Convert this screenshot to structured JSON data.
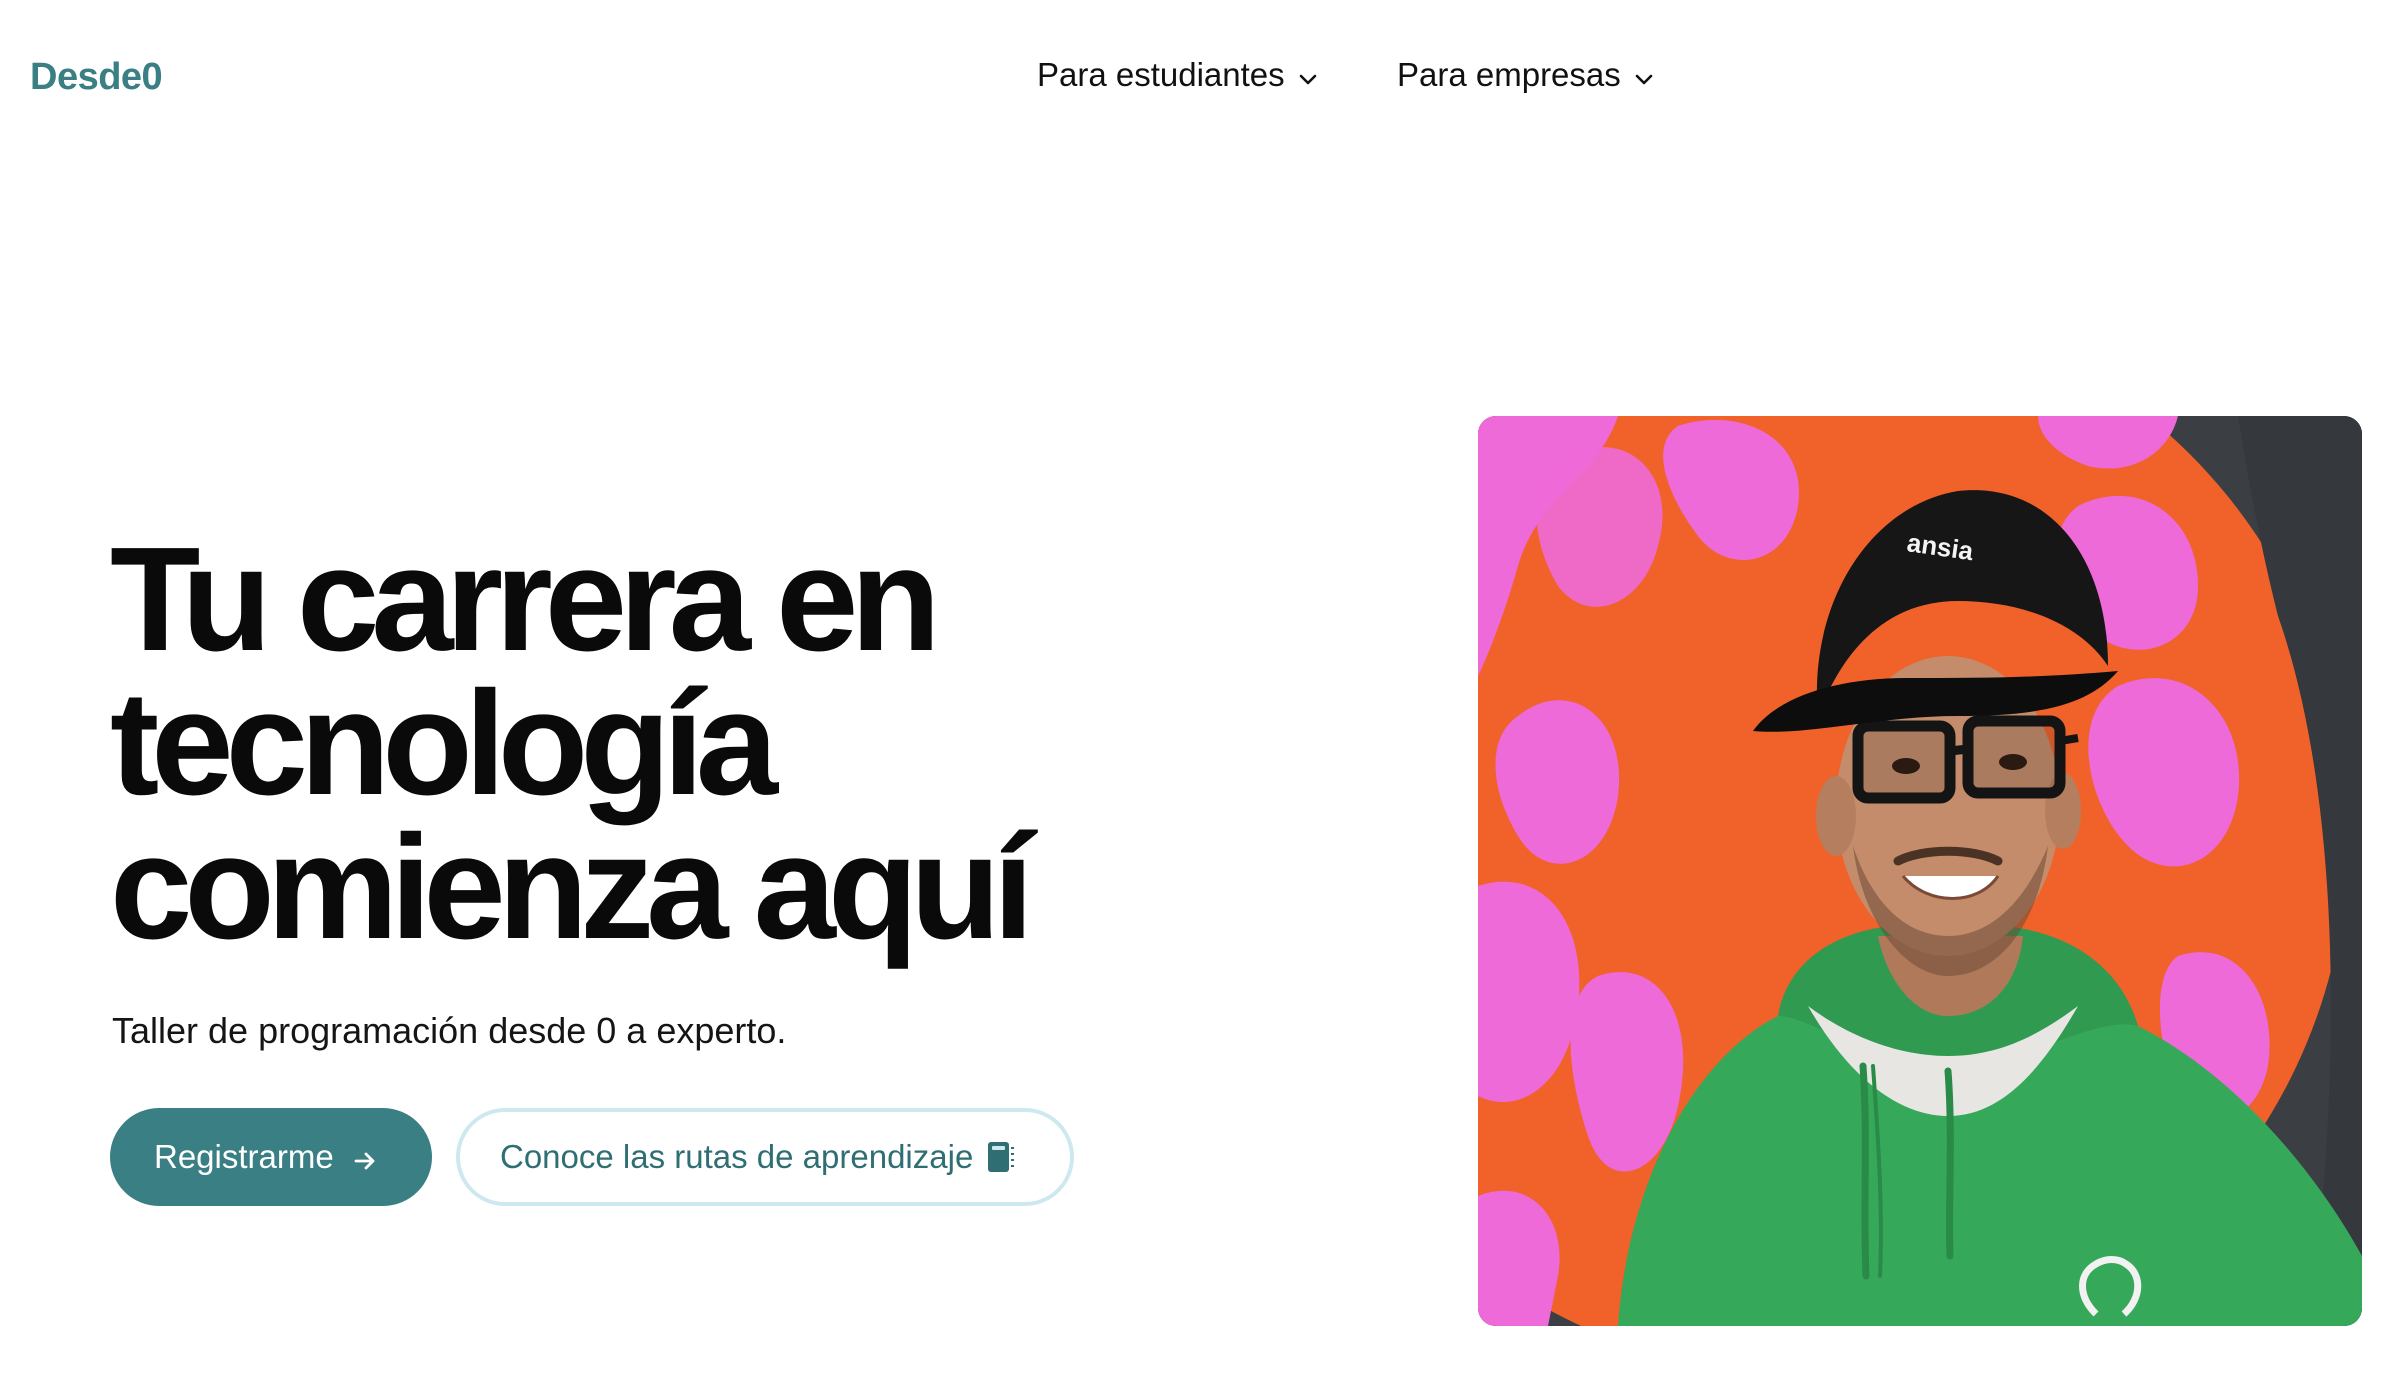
{
  "header": {
    "logo": "Desde0",
    "nav": [
      {
        "label": "Para estudiantes"
      },
      {
        "label": "Para empresas"
      }
    ]
  },
  "hero": {
    "title_lines": [
      "Tu carrera en",
      "tecnología",
      "comienza aquí"
    ],
    "subtitle": "Taller de programación desde 0 a experto.",
    "primary_button": "Registrarme",
    "secondary_button": "Conoce las rutas de aprendizaje"
  },
  "colors": {
    "brand": "#3a7f84",
    "secondary_border": "#cde9ef",
    "text": "#0a0a0a"
  },
  "icons": {
    "nav_dropdown": "chevron-down-icon",
    "primary_button": "arrow-right-icon",
    "secondary_button": "notebook-icon"
  },
  "photo": {
    "cap_text": "ansia"
  }
}
